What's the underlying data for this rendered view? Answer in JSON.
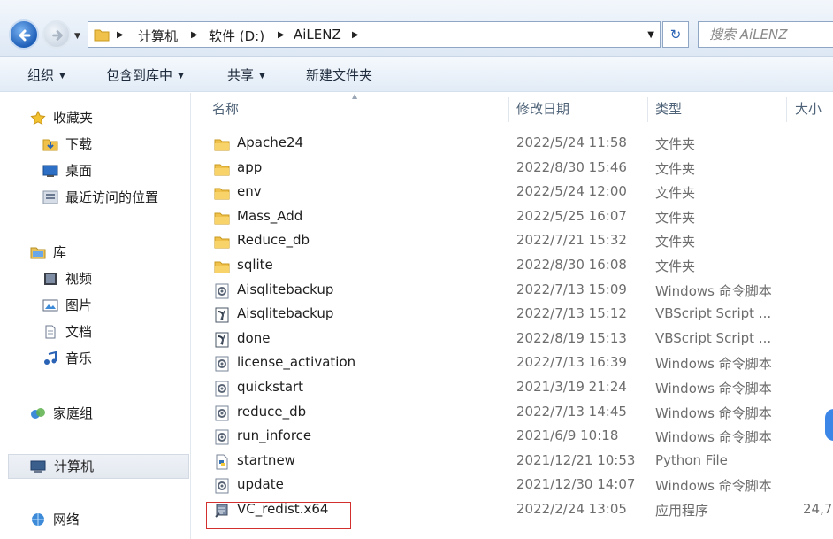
{
  "address": {
    "crumbs": [
      "计算机",
      "软件 (D:)",
      "AiLENZ"
    ],
    "search_placeholder": "搜索 AiLENZ"
  },
  "toolbar": {
    "organize": "组织",
    "include_in_library": "包含到库中",
    "share": "共享",
    "new_folder": "新建文件夹"
  },
  "sidebar": {
    "favorites": {
      "label": "收藏夹",
      "items": [
        "下载",
        "桌面",
        "最近访问的位置"
      ]
    },
    "libraries": {
      "label": "库",
      "items": [
        "视频",
        "图片",
        "文档",
        "音乐"
      ]
    },
    "homegroup": "家庭组",
    "computer": "计算机",
    "network": "网络"
  },
  "columns": {
    "name": "名称",
    "date": "修改日期",
    "type": "类型",
    "size": "大小"
  },
  "files": [
    {
      "name": "Apache24",
      "date": "2022/5/24 11:58",
      "type": "文件夹",
      "size": "",
      "icon": "folder-icon"
    },
    {
      "name": "app",
      "date": "2022/8/30 15:46",
      "type": "文件夹",
      "size": "",
      "icon": "folder-icon"
    },
    {
      "name": "env",
      "date": "2022/5/24 12:00",
      "type": "文件夹",
      "size": "",
      "icon": "folder-icon"
    },
    {
      "name": "Mass_Add",
      "date": "2022/5/25 16:07",
      "type": "文件夹",
      "size": "",
      "icon": "folder-icon"
    },
    {
      "name": "Reduce_db",
      "date": "2022/7/21 15:32",
      "type": "文件夹",
      "size": "",
      "icon": "folder-icon"
    },
    {
      "name": "sqlite",
      "date": "2022/8/30 16:08",
      "type": "文件夹",
      "size": "",
      "icon": "folder-icon"
    },
    {
      "name": "Aisqlitebackup",
      "date": "2022/7/13 15:09",
      "type": "Windows 命令脚本",
      "size": "",
      "icon": "cmd-script-icon"
    },
    {
      "name": "Aisqlitebackup",
      "date": "2022/7/13 15:12",
      "type": "VBScript Script ...",
      "size": "",
      "icon": "vbscript-icon"
    },
    {
      "name": "done",
      "date": "2022/8/19 15:13",
      "type": "VBScript Script ...",
      "size": "",
      "icon": "vbscript-icon"
    },
    {
      "name": "license_activation",
      "date": "2022/7/13 16:39",
      "type": "Windows 命令脚本",
      "size": "",
      "icon": "cmd-script-icon"
    },
    {
      "name": "quickstart",
      "date": "2021/3/19 21:24",
      "type": "Windows 命令脚本",
      "size": "",
      "icon": "cmd-script-icon"
    },
    {
      "name": "reduce_db",
      "date": "2022/7/13 14:45",
      "type": "Windows 命令脚本",
      "size": "",
      "icon": "cmd-script-icon"
    },
    {
      "name": "run_inforce",
      "date": "2021/6/9 10:18",
      "type": "Windows 命令脚本",
      "size": "",
      "icon": "cmd-script-icon"
    },
    {
      "name": "startnew",
      "date": "2021/12/21 10:53",
      "type": "Python File",
      "size": "",
      "icon": "python-file-icon"
    },
    {
      "name": "update",
      "date": "2021/12/30 14:07",
      "type": "Windows 命令脚本",
      "size": "",
      "icon": "cmd-script-icon"
    },
    {
      "name": "VC_redist.x64",
      "date": "2022/2/24 13:05",
      "type": "应用程序",
      "size": "24,7",
      "icon": "application-icon"
    }
  ]
}
